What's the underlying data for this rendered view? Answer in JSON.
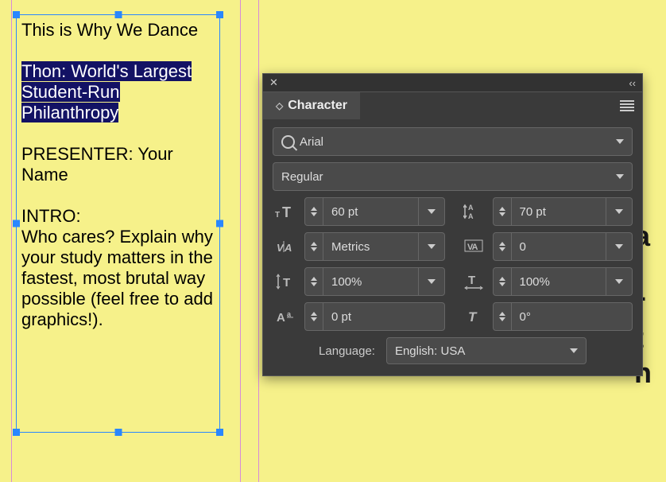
{
  "document": {
    "line1": "This is Why We Dance",
    "highlight_l1": "Thon: World's Largest",
    "highlight_l2": "Student-Run Philanthropy",
    "presenter_label": "PRESENTER: Your Name",
    "intro_label": "INTRO:",
    "intro_body": "Who cares? Explain why your study matters in the fastest, most brutal way possible (feel free to add graphics!).",
    "right_clip": "a\nr\nt\nn"
  },
  "panel": {
    "title": "Character",
    "font_family": "Arial",
    "font_style": "Regular",
    "font_size": "60 pt",
    "leading": "70 pt",
    "kerning": "Metrics",
    "tracking": "0",
    "vscale": "100%",
    "hscale": "100%",
    "baseline_shift": "0 pt",
    "skew": "0°",
    "language_label": "Language:",
    "language_value": "English: USA"
  }
}
